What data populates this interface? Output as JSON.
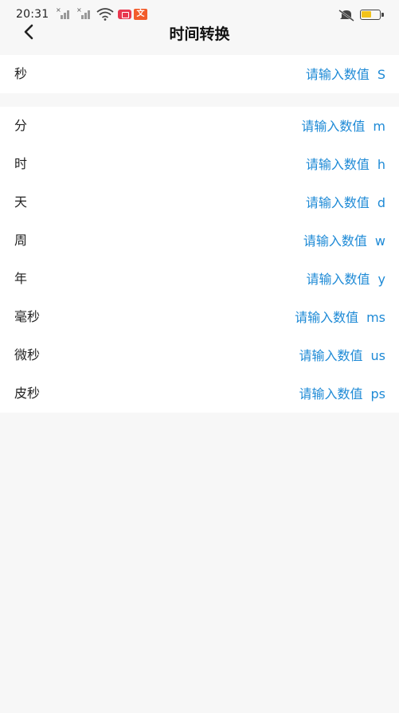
{
  "status_bar": {
    "time": "20:31",
    "signal_1": "signal-no-sim-icon",
    "signal_2": "signal-no-sim-icon",
    "wifi": "wifi-icon",
    "notify_app_1": "video-app-icon",
    "notify_app_2": "shop-app-icon",
    "notify_app_2_glyph": "文",
    "silent": "mute-icon",
    "battery": "battery-icon",
    "battery_color": "#f2c31b"
  },
  "header": {
    "back_icon": "chevron-left-icon",
    "title": "时间转换"
  },
  "colors": {
    "accent": "#1e8ad6",
    "background": "#f7f7f7",
    "card": "#ffffff"
  },
  "rows": [
    {
      "label": "秒",
      "placeholder": "请输入数值",
      "unit": "S"
    },
    {
      "label": "分",
      "placeholder": "请输入数值",
      "unit": "m"
    },
    {
      "label": "时",
      "placeholder": "请输入数值",
      "unit": "h"
    },
    {
      "label": "天",
      "placeholder": "请输入数值",
      "unit": "d"
    },
    {
      "label": "周",
      "placeholder": "请输入数值",
      "unit": "w"
    },
    {
      "label": "年",
      "placeholder": "请输入数值",
      "unit": "y"
    },
    {
      "label": "毫秒",
      "placeholder": "请输入数值",
      "unit": "ms"
    },
    {
      "label": "微秒",
      "placeholder": "请输入数值",
      "unit": "us"
    },
    {
      "label": "皮秒",
      "placeholder": "请输入数值",
      "unit": "ps"
    }
  ]
}
